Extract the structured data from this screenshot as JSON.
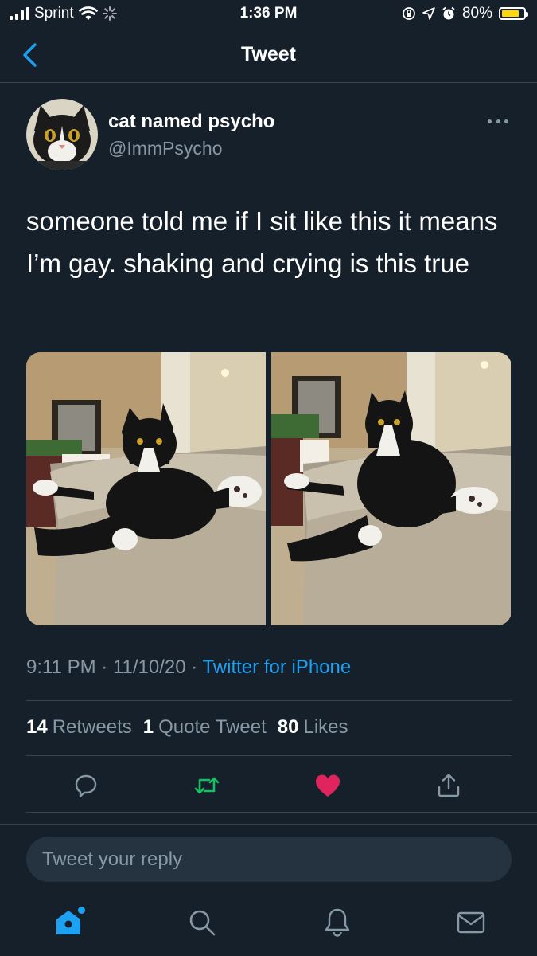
{
  "status_bar": {
    "carrier": "Sprint",
    "time": "1:36 PM",
    "battery_percent": "80%",
    "battery_level": 0.8
  },
  "nav": {
    "title": "Tweet",
    "back_icon": "chevron-left-icon"
  },
  "tweet": {
    "display_name": "cat named psycho",
    "handle": "@ImmPsycho",
    "text": "someone told me if I sit like this it means I’m gay. shaking and crying is this true",
    "timestamp": "9:11 PM · 11/10/20 · ",
    "source": "Twitter for iPhone",
    "stats": {
      "retweets_count": "14",
      "retweets_label": "Retweets",
      "quotes_count": "1",
      "quotes_label": "Quote Tweet",
      "likes_count": "80",
      "likes_label": "Likes"
    },
    "actions": [
      "reply-icon",
      "retweet-icon",
      "heart-icon",
      "share-icon"
    ]
  },
  "reply": {
    "placeholder": "Tweet your reply"
  },
  "tabbar": [
    "home-icon",
    "search-icon",
    "notifications-icon",
    "messages-icon"
  ],
  "colors": {
    "background": "#15202b",
    "accent": "#1da1f2",
    "muted": "#8899a6",
    "retweet": "#17bf63",
    "like": "#e0245e",
    "battery": "#ffd60a"
  }
}
